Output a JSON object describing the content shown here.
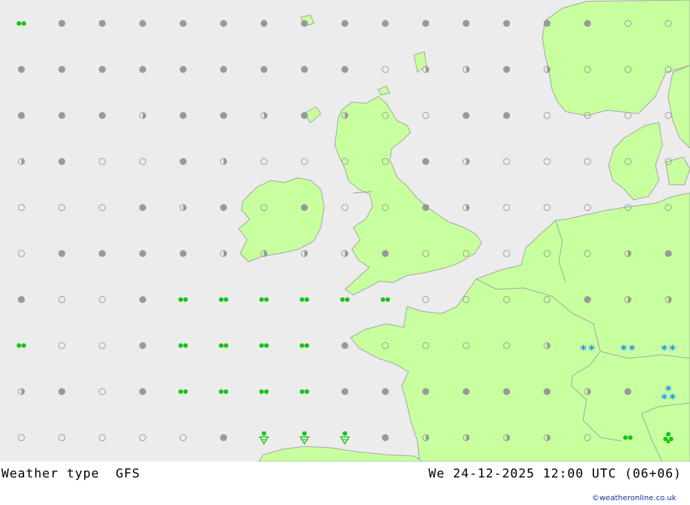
{
  "title": {
    "product": "Weather type",
    "model": "GFS",
    "valid_time": "We 24-12-2025 12:00 UTC (06+06)"
  },
  "credit": "©weatheronline.co.uk",
  "colors": {
    "sea": "#ececec",
    "land": "#c8ff9f",
    "coast": "#a0a0a0",
    "cloud_symbol": "#999999",
    "rain": "#16c316",
    "snow": "#1e8cff"
  },
  "legend_symbols": {
    "o": "clear-icon",
    "h": "partly-cloudy-icon",
    "f": "overcast-icon",
    "r": "rain-icon",
    "s": "snow-icon",
    "sw": "snow-shower-icon",
    "rw": "rain-shower-icon",
    "t": "heavy-rain-icon"
  },
  "grid": [
    [
      "r",
      "f",
      "f",
      "f",
      "f",
      "f",
      "f",
      "f",
      "f",
      "f",
      "f",
      "f",
      "f",
      "f",
      "f",
      "o",
      "o"
    ],
    [
      "f",
      "f",
      "f",
      "f",
      "f",
      "f",
      "f",
      "f",
      "f",
      "o",
      "h",
      "h",
      "f",
      "h",
      "o",
      "o",
      "o"
    ],
    [
      "f",
      "f",
      "f",
      "h",
      "f",
      "f",
      "h",
      "f",
      "h",
      "o",
      "o",
      "f",
      "f",
      "o",
      "o",
      "o",
      "o"
    ],
    [
      "h",
      "f",
      "o",
      "o",
      "f",
      "h",
      "o",
      "o",
      "o",
      "o",
      "f",
      "h",
      "o",
      "o",
      "o",
      "o",
      "o"
    ],
    [
      "o",
      "o",
      "o",
      "f",
      "h",
      "f",
      "o",
      "f",
      "o",
      "o",
      "f",
      "h",
      "o",
      "o",
      "o",
      "o",
      "o"
    ],
    [
      "o",
      "f",
      "f",
      "f",
      "f",
      "h",
      "h",
      "h",
      "h",
      "f",
      "o",
      "o",
      "o",
      "o",
      "o",
      "h",
      "f"
    ],
    [
      "f",
      "o",
      "o",
      "f",
      "r",
      "r",
      "r",
      "r",
      "r",
      "r",
      "o",
      "o",
      "o",
      "o",
      "f",
      "h",
      "h"
    ],
    [
      "r",
      "o",
      "o",
      "f",
      "r",
      "r",
      "r",
      "r",
      "f",
      "o",
      "o",
      "o",
      "o",
      "h",
      "s",
      "s",
      "s"
    ],
    [
      "h",
      "f",
      "o",
      "f",
      "r",
      "r",
      "r",
      "r",
      "f",
      "f",
      "f",
      "f",
      "f",
      "f",
      "h",
      "f",
      "sw"
    ],
    [
      "o",
      "o",
      "o",
      "o",
      "o",
      "f",
      "rw",
      "rw",
      "rw",
      "f",
      "h",
      "h",
      "h",
      "h",
      "o",
      "r",
      "t"
    ]
  ]
}
